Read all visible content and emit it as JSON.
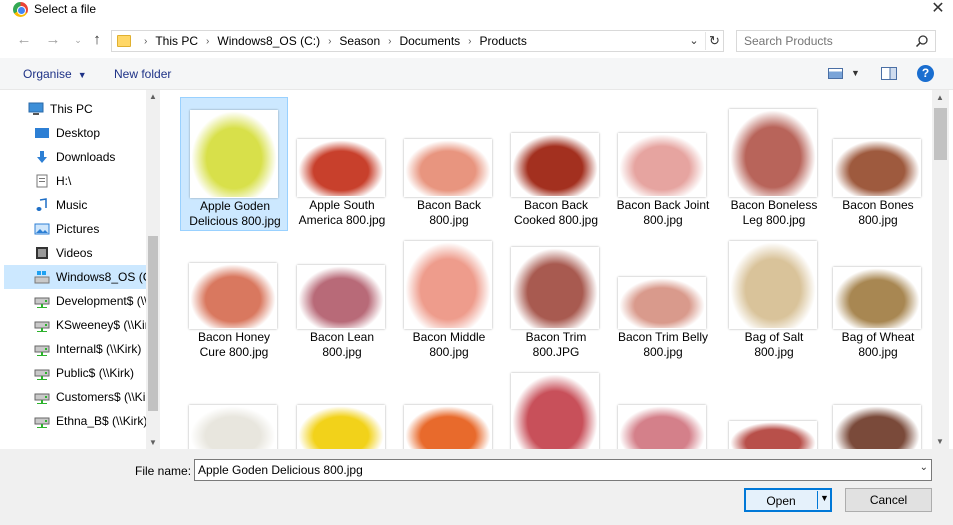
{
  "window": {
    "title": "Select a file",
    "close_glyph": "✕"
  },
  "address": {
    "crumbs": [
      "This PC",
      "Windows8_OS (C:)",
      "Season",
      "Documents",
      "Products"
    ],
    "separator": "›"
  },
  "search": {
    "placeholder": "Search Products"
  },
  "toolbar": {
    "organise_label": "Organise",
    "new_folder_label": "New folder",
    "help_glyph": "?"
  },
  "sidebar": {
    "items": [
      {
        "label": "This PC",
        "icon": "pc-icon"
      },
      {
        "label": "Desktop",
        "icon": "desktop-icon"
      },
      {
        "label": "Downloads",
        "icon": "downloads-icon"
      },
      {
        "label": "H:\\",
        "icon": "drive-icon"
      },
      {
        "label": "Music",
        "icon": "music-icon"
      },
      {
        "label": "Pictures",
        "icon": "pictures-icon"
      },
      {
        "label": "Videos",
        "icon": "videos-icon"
      },
      {
        "label": "Windows8_OS (C:)",
        "icon": "windows-drive-icon"
      },
      {
        "label": "Development$ (\\\\Kirk)",
        "icon": "network-drive-icon"
      },
      {
        "label": "KSweeney$ (\\\\Kirk)",
        "icon": "network-drive-icon"
      },
      {
        "label": "Internal$ (\\\\Kirk)",
        "icon": "network-drive-icon"
      },
      {
        "label": "Public$ (\\\\Kirk)",
        "icon": "network-drive-icon"
      },
      {
        "label": "Customers$ (\\\\Kirk)",
        "icon": "network-drive-icon"
      },
      {
        "label": "Ethna_B$ (\\\\Kirk)",
        "icon": "network-drive-icon"
      }
    ],
    "selected_index": 7
  },
  "files": [
    {
      "line1": "Apple Goden",
      "line2": "Delicious 800.jpg",
      "color": "#d8e04a"
    },
    {
      "line1": "Apple South",
      "line2": "America 800.jpg",
      "color": "#c8402c"
    },
    {
      "line1": "Bacon Back",
      "line2": "800.jpg",
      "color": "#e8957f"
    },
    {
      "line1": "Bacon Back",
      "line2": "Cooked 800.jpg",
      "color": "#a3301f"
    },
    {
      "line1": "Bacon Back Joint",
      "line2": "800.jpg",
      "color": "#e6a4a0"
    },
    {
      "line1": "Bacon Boneless",
      "line2": "Leg 800.jpg",
      "color": "#b8645a"
    },
    {
      "line1": "Bacon Bones",
      "line2": "800.jpg",
      "color": "#9e5a3e"
    },
    {
      "line1": "Bacon Honey",
      "line2": "Cure 800.jpg",
      "color": "#d9785f"
    },
    {
      "line1": "Bacon Lean",
      "line2": "800.jpg",
      "color": "#b86a78"
    },
    {
      "line1": "Bacon Middle",
      "line2": "800.jpg",
      "color": "#ee9c8c"
    },
    {
      "line1": "Bacon Trim",
      "line2": "800.JPG",
      "color": "#a85a50"
    },
    {
      "line1": "Bacon Trim Belly",
      "line2": "800.jpg",
      "color": "#d99a8c"
    },
    {
      "line1": "Bag of Salt",
      "line2": "800.jpg",
      "color": "#d9c39a"
    },
    {
      "line1": "Bag of Wheat",
      "line2": "800.jpg",
      "color": "#a88752"
    },
    {
      "line1": "",
      "line2": "",
      "color": "#e8e6de"
    },
    {
      "line1": "",
      "line2": "",
      "color": "#f2d21a"
    },
    {
      "line1": "",
      "line2": "",
      "color": "#e86a2c"
    },
    {
      "line1": "",
      "line2": "",
      "color": "#c8505a"
    },
    {
      "line1": "",
      "line2": "",
      "color": "#d4808a"
    },
    {
      "line1": "",
      "line2": "",
      "color": "#b8504a"
    },
    {
      "line1": "",
      "line2": "",
      "color": "#7a4a3a"
    }
  ],
  "bottom": {
    "file_name_label": "File name:",
    "file_name_value": "Apple Goden Delicious 800.jpg",
    "open_label": "Open",
    "cancel_label": "Cancel"
  }
}
